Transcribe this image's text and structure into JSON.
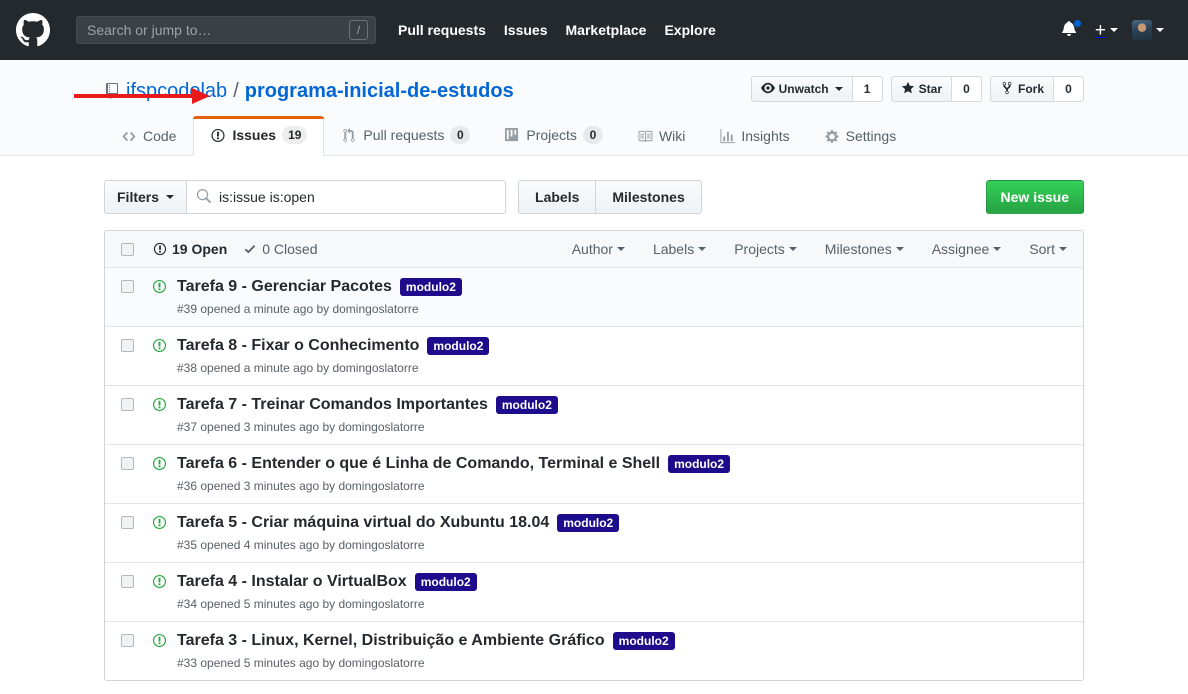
{
  "header": {
    "logo_icon": "github-mark-icon",
    "search": {
      "placeholder": "Search or jump to…",
      "value": "",
      "shortcut_key": "/"
    },
    "nav": [
      {
        "label": "Pull requests"
      },
      {
        "label": "Issues"
      },
      {
        "label": "Marketplace"
      },
      {
        "label": "Explore"
      }
    ],
    "notifications_icon": "bell-icon",
    "has_unread_notifications": true,
    "create_new_icon": "plus-icon",
    "profile_icon": "avatar"
  },
  "repo": {
    "icon": "repo-book-icon",
    "owner": "ifspcodelab",
    "separator": "/",
    "name": "programa-inicial-de-estudos",
    "actions": [
      {
        "label": "Unwatch",
        "icon": "eye-icon",
        "count": "1",
        "has_caret": true
      },
      {
        "label": "Star",
        "icon": "star-icon",
        "count": "0",
        "has_caret": false
      },
      {
        "label": "Fork",
        "icon": "fork-icon",
        "count": "0",
        "has_caret": false
      }
    ],
    "tabs": [
      {
        "label": "Code",
        "icon": "code-icon",
        "count": null,
        "selected": false
      },
      {
        "label": "Issues",
        "icon": "issue-opened-icon",
        "count": "19",
        "selected": true
      },
      {
        "label": "Pull requests",
        "icon": "git-pull-request-icon",
        "count": "0",
        "selected": false
      },
      {
        "label": "Projects",
        "icon": "project-board-icon",
        "count": "0",
        "selected": false
      },
      {
        "label": "Wiki",
        "icon": "book-icon",
        "count": null,
        "selected": false
      },
      {
        "label": "Insights",
        "icon": "graph-icon",
        "count": null,
        "selected": false
      },
      {
        "label": "Settings",
        "icon": "gear-icon",
        "count": null,
        "selected": false
      }
    ],
    "annotation": {
      "type": "red-arrow",
      "color": "#e8191a",
      "points_to": "Issues tab"
    }
  },
  "subnav": {
    "filters_label": "Filters",
    "search_value": "is:issue is:open",
    "search_icon": "search-icon",
    "labels_label": "Labels",
    "milestones_label": "Milestones",
    "new_issue_label": "New issue"
  },
  "issues_header": {
    "open_count_label": "19 Open",
    "closed_count_label": "0 Closed",
    "open_icon": "issue-opened-icon",
    "closed_icon": "check-icon",
    "filters": [
      {
        "label": "Author"
      },
      {
        "label": "Labels"
      },
      {
        "label": "Projects"
      },
      {
        "label": "Milestones"
      },
      {
        "label": "Assignee"
      },
      {
        "label": "Sort"
      }
    ]
  },
  "label_colors": {
    "modulo2_bg": "#1d0d8c",
    "modulo2_fg": "#ffffff"
  },
  "issues": [
    {
      "title": "Tarefa 9 - Gerenciar Pacotes",
      "label": "modulo2",
      "meta": "#39 opened a minute ago by domingoslatorre",
      "state": "open"
    },
    {
      "title": "Tarefa 8 - Fixar o Conhecimento",
      "label": "modulo2",
      "meta": "#38 opened a minute ago by domingoslatorre",
      "state": "open"
    },
    {
      "title": "Tarefa 7 - Treinar Comandos Importantes",
      "label": "modulo2",
      "meta": "#37 opened 3 minutes ago by domingoslatorre",
      "state": "open"
    },
    {
      "title": "Tarefa 6 - Entender o que é Linha de Comando, Terminal e Shell",
      "label": "modulo2",
      "meta": "#36 opened 3 minutes ago by domingoslatorre",
      "state": "open"
    },
    {
      "title": "Tarefa 5 - Criar máquina virtual do Xubuntu 18.04",
      "label": "modulo2",
      "meta": "#35 opened 4 minutes ago by domingoslatorre",
      "state": "open"
    },
    {
      "title": "Tarefa 4 - Instalar o VirtualBox",
      "label": "modulo2",
      "meta": "#34 opened 5 minutes ago by domingoslatorre",
      "state": "open"
    },
    {
      "title": "Tarefa 3 - Linux, Kernel, Distribuição e Ambiente Gráfico",
      "label": "modulo2",
      "meta": "#33 opened 5 minutes ago by domingoslatorre",
      "state": "open"
    }
  ]
}
